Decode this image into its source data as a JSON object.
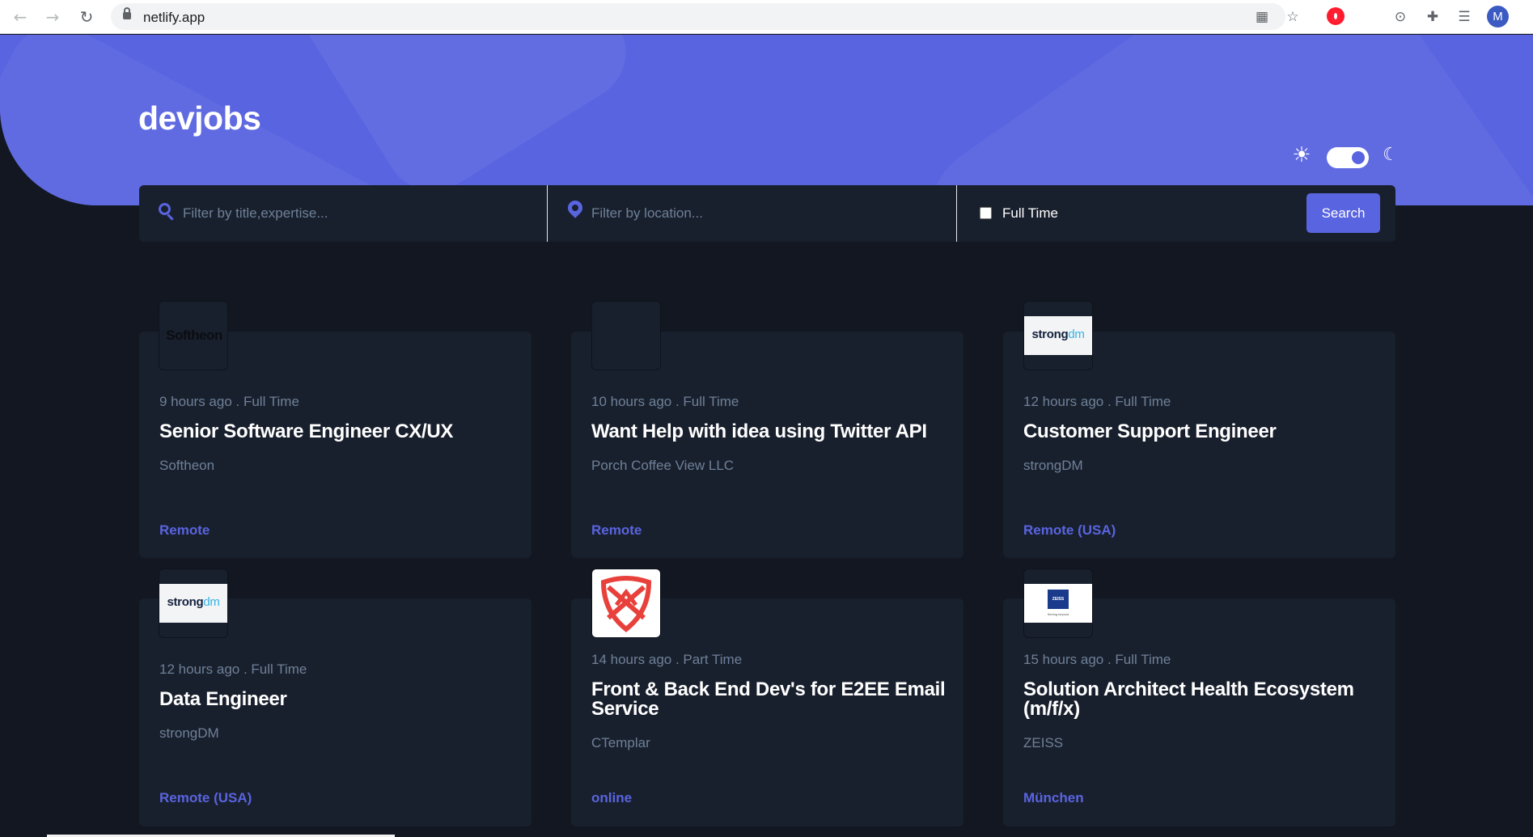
{
  "browser": {
    "url": "netlify.app",
    "avatar_letter": "M",
    "icons": {
      "back": "arrow-left-icon",
      "forward": "arrow-right-icon",
      "reload": "reload-icon",
      "lock": "lock-icon",
      "qr": "qr-code-icon",
      "star": "bookmark-star-icon",
      "opera": "opera-icon",
      "vpn": "vpn-icon",
      "extensions": "puzzle-icon",
      "playlist": "playlist-icon"
    }
  },
  "header": {
    "logo": "devjobs",
    "theme_toggle": {
      "mode": "dark",
      "sun_icon": "sun-icon",
      "moon_icon": "moon-icon"
    }
  },
  "search": {
    "title_placeholder": "Filter by title,expertise...",
    "location_placeholder": "Filter by location...",
    "fulltime_label": "Full Time",
    "fulltime_checked": false,
    "button_label": "Search"
  },
  "jobs": [
    {
      "logo": "Softheon",
      "posted": "9 hours ago . Full Time",
      "title": "Senior Software Engineer CX/UX",
      "company": "Softheon",
      "location": "Remote"
    },
    {
      "logo": "",
      "posted": "10 hours ago . Full Time",
      "title": "Want Help with idea using Twitter API",
      "company": "Porch Coffee View LLC",
      "location": "Remote"
    },
    {
      "logo": "strongdm",
      "posted": "12 hours ago . Full Time",
      "title": "Customer Support Engineer",
      "company": "strongDM",
      "location": "Remote (USA)"
    },
    {
      "logo": "strongdm",
      "posted": "12 hours ago . Full Time",
      "title": "Data Engineer",
      "company": "strongDM",
      "location": "Remote (USA)"
    },
    {
      "logo": "ctemplar",
      "posted": "14 hours ago . Part Time",
      "title": "Front & Back End Dev's for E2EE Email Service",
      "company": "CTemplar",
      "location": "online"
    },
    {
      "logo": "ZEISS",
      "posted": "15 hours ago . Full Time",
      "title": "Solution Architect Health Ecosystem (m/f/x)",
      "company": "ZEISS",
      "location": "München"
    }
  ],
  "logos": {
    "strong": "strong",
    "dm": "dm",
    "zeiss_word": "ZEISS",
    "zeiss_tagline": "Seeing beyond"
  },
  "colors": {
    "accent": "#5964e0",
    "background": "#121721",
    "card": "#19202d",
    "muted_text": "#6e8098"
  }
}
